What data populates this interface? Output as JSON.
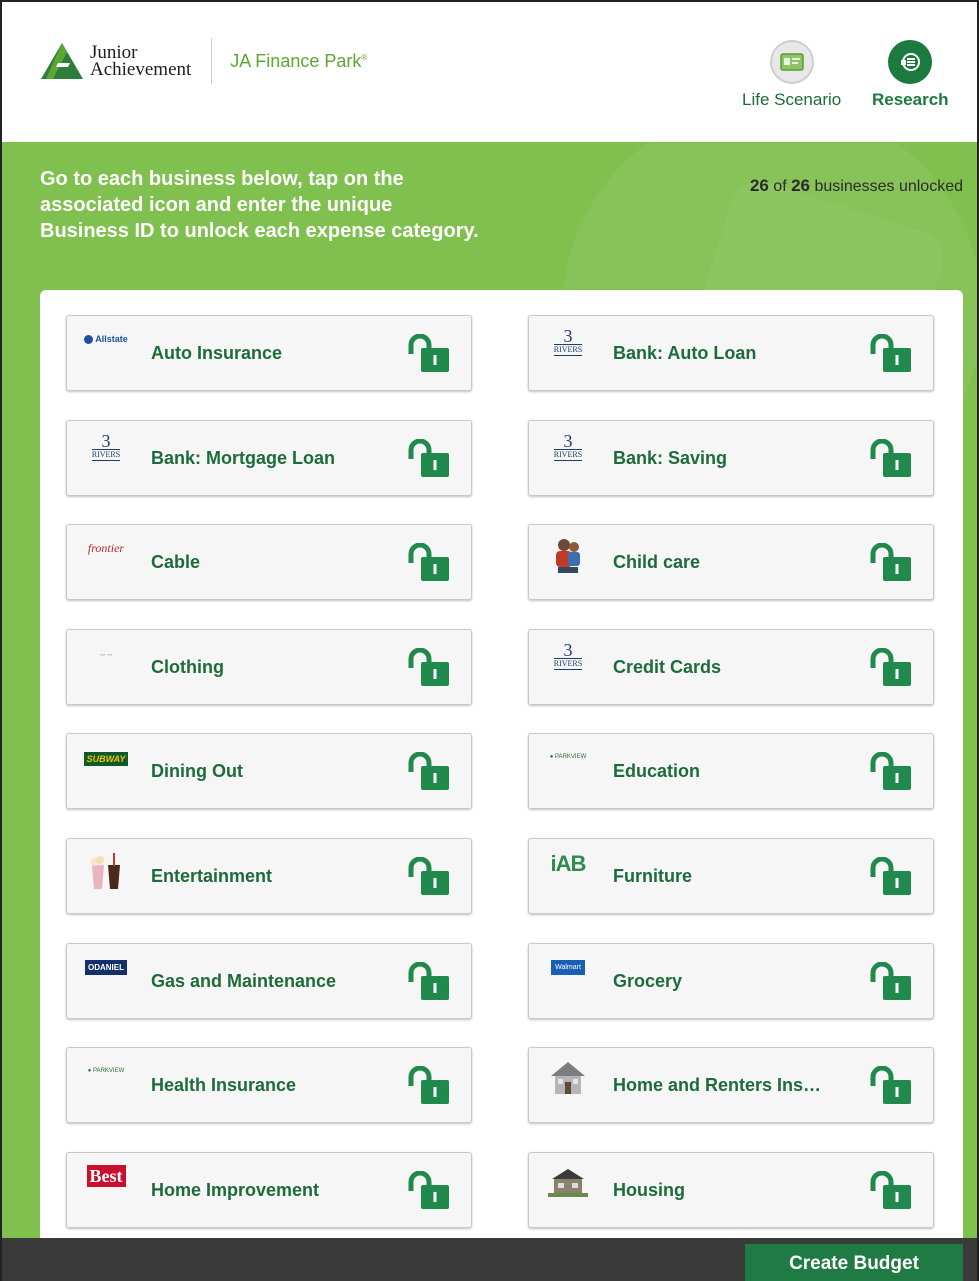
{
  "header": {
    "brand_line1": "Junior",
    "brand_line2": "Achievement",
    "product": "JA Finance Park",
    "life_scenario_label": "Life Scenario",
    "research_label": "Research"
  },
  "banner": {
    "instructions": "Go to each business below, tap on the associated icon and enter the unique Business ID to unlock each expense category.",
    "unlocked_count": "26",
    "unlocked_of": " of ",
    "unlocked_total": "26",
    "unlocked_suffix": " businesses unlocked"
  },
  "categories": [
    {
      "label": "Auto Insurance",
      "logo": "allstate-logo"
    },
    {
      "label": "Bank: Auto Loan",
      "logo": "3-rivers-logo"
    },
    {
      "label": "Bank: Mortgage Loan",
      "logo": "3-rivers-logo"
    },
    {
      "label": "Bank: Saving",
      "logo": "3-rivers-logo"
    },
    {
      "label": "Cable",
      "logo": "frontier-logo"
    },
    {
      "label": "Child care",
      "logo": "child-care-photo"
    },
    {
      "label": "Clothing",
      "logo": "clothing-logo"
    },
    {
      "label": "Credit Cards",
      "logo": "3-rivers-logo"
    },
    {
      "label": "Dining Out",
      "logo": "subway-logo"
    },
    {
      "label": "Education",
      "logo": "parkview-logo"
    },
    {
      "label": "Entertainment",
      "logo": "popcorn-drink-icon"
    },
    {
      "label": "Furniture",
      "logo": "iab-logo"
    },
    {
      "label": "Gas and Maintenance",
      "logo": "odaniel-logo"
    },
    {
      "label": "Grocery",
      "logo": "walmart-logo"
    },
    {
      "label": "Health Insurance",
      "logo": "parkview-logo"
    },
    {
      "label": "Home and Renters Insur...",
      "logo": "house-icon"
    },
    {
      "label": "Home Improvement",
      "logo": "do-it-best-logo"
    },
    {
      "label": "Housing",
      "logo": "house-photo"
    }
  ],
  "logo_text": {
    "allstate": "Allstate",
    "rivers_num": "3",
    "rivers_word": "RIVERS",
    "frontier": "frontier",
    "subway": "SUBWAY",
    "parkview": "● PARKVIEW",
    "iab": "iAB",
    "odaniel": "ODANIEL",
    "walmart": "Walmart",
    "best": "Best"
  },
  "colors": {
    "accent_green": "#80c04f",
    "dark_green": "#1d6b3b",
    "lock_green": "#1f8a4c"
  },
  "footer": {
    "create_budget_label": "Create Budget"
  }
}
